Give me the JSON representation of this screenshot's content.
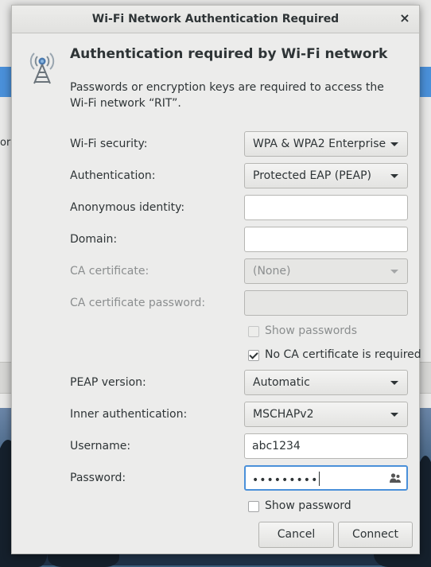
{
  "background": {
    "partial_text": "ork"
  },
  "dialog": {
    "title": "Wi-Fi Network Authentication Required",
    "close_glyph": "×",
    "heading": "Authentication required by Wi-Fi network",
    "description": "Passwords or encryption keys are required to access the Wi-Fi network “RIT”.",
    "icon": "wifi-tower-icon"
  },
  "form": {
    "wifi_security": {
      "label": "Wi-Fi security:",
      "value": "WPA & WPA2 Enterprise"
    },
    "authentication": {
      "label": "Authentication:",
      "value": "Protected EAP (PEAP)"
    },
    "anonymous_identity": {
      "label": "Anonymous identity:",
      "value": ""
    },
    "domain": {
      "label": "Domain:",
      "value": ""
    },
    "ca_certificate": {
      "label": "CA certificate:",
      "value": "(None)"
    },
    "ca_certificate_password": {
      "label": "CA certificate password:",
      "value": ""
    },
    "show_passwords": {
      "label": "Show passwords",
      "checked": false
    },
    "no_ca_required": {
      "label": "No CA certificate is required",
      "checked": true
    },
    "peap_version": {
      "label": "PEAP version:",
      "value": "Automatic"
    },
    "inner_authentication": {
      "label": "Inner authentication:",
      "value": "MSCHAPv2"
    },
    "username": {
      "label": "Username:",
      "value": "abc1234"
    },
    "password": {
      "label": "Password:",
      "value": "•••••••••",
      "icon": "user-password-icon"
    },
    "show_password": {
      "label": "Show password",
      "checked": false
    }
  },
  "buttons": {
    "cancel": "Cancel",
    "connect": "Connect"
  },
  "colors": {
    "focus": "#4a90d9",
    "dialog_bg": "#ececeb",
    "dim_text": "#8b8e8f"
  }
}
